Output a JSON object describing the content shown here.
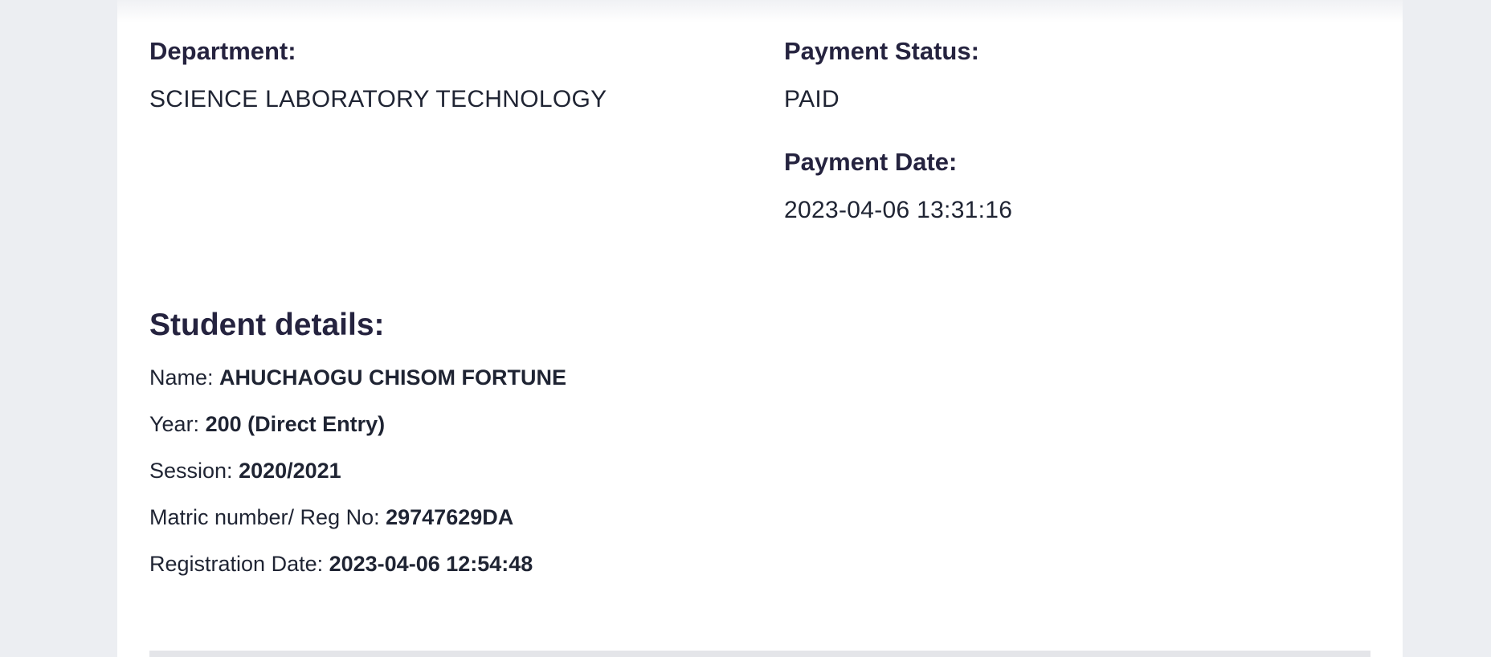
{
  "payment_info": {
    "department_label": "Department:",
    "department_value": "SCIENCE LABORATORY TECHNOLOGY",
    "payment_status_label": "Payment Status:",
    "payment_status_value": "PAID",
    "payment_date_label": "Payment Date:",
    "payment_date_value": "2023-04-06 13:31:16"
  },
  "student": {
    "title": "Student details:",
    "rows": [
      {
        "label": "Name: ",
        "value": "AHUCHAOGU CHISOM FORTUNE"
      },
      {
        "label": "Year: ",
        "value": "200 (Direct Entry)"
      },
      {
        "label": "Session: ",
        "value": "2020/2021"
      },
      {
        "label": "Matric number/ Reg No: ",
        "value": "29747629DA"
      },
      {
        "label": "Registration Date: ",
        "value": "2023-04-06 12:54:48"
      }
    ]
  }
}
